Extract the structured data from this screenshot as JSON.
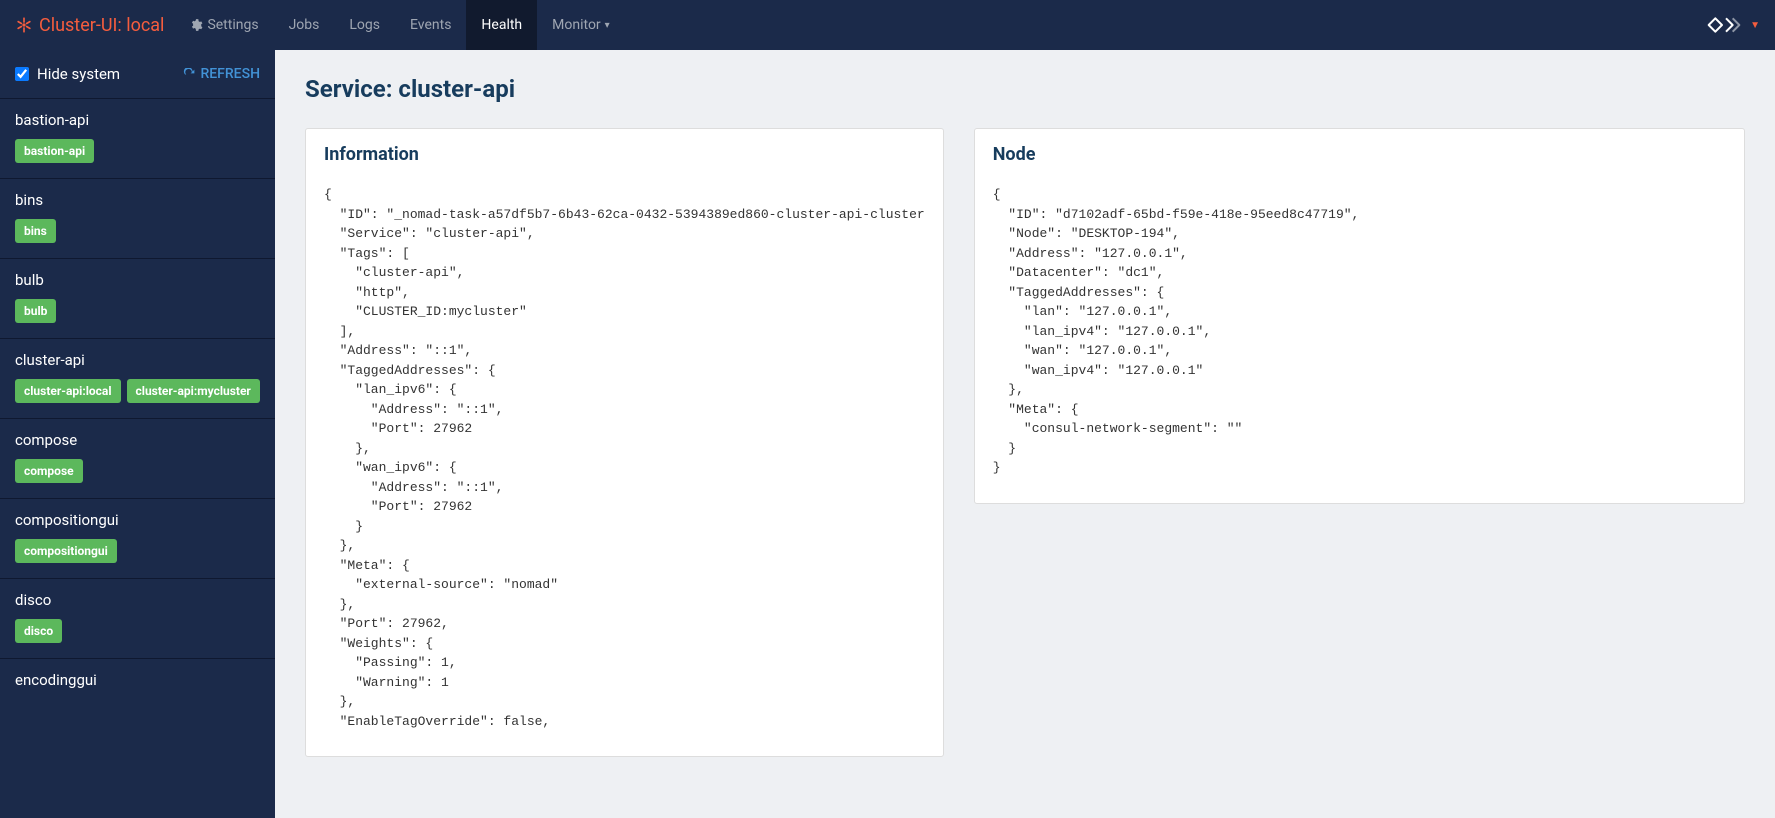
{
  "navbar": {
    "brand": "Cluster-UI: local",
    "settings": "Settings",
    "items": [
      "Jobs",
      "Logs",
      "Events",
      "Health",
      "Monitor"
    ],
    "active": "Health"
  },
  "sidebar": {
    "hide_label": "Hide system",
    "hide_checked": true,
    "refresh": "REFRESH",
    "services": [
      {
        "name": "bastion-api",
        "tags": [
          "bastion-api"
        ]
      },
      {
        "name": "bins",
        "tags": [
          "bins"
        ]
      },
      {
        "name": "bulb",
        "tags": [
          "bulb"
        ]
      },
      {
        "name": "cluster-api",
        "tags": [
          "cluster-api:local",
          "cluster-api:mycluster"
        ]
      },
      {
        "name": "compose",
        "tags": [
          "compose"
        ]
      },
      {
        "name": "compositiongui",
        "tags": [
          "compositiongui"
        ]
      },
      {
        "name": "disco",
        "tags": [
          "disco"
        ]
      },
      {
        "name": "encodinggui",
        "tags": []
      }
    ]
  },
  "page": {
    "title": "Service: cluster-api",
    "info_header": "Information",
    "node_header": "Node",
    "info_json": "{\n  \"ID\": \"_nomad-task-a57df5b7-6b43-62ca-0432-5394389ed860-cluster-api-cluster\n  \"Service\": \"cluster-api\",\n  \"Tags\": [\n    \"cluster-api\",\n    \"http\",\n    \"CLUSTER_ID:mycluster\"\n  ],\n  \"Address\": \"::1\",\n  \"TaggedAddresses\": {\n    \"lan_ipv6\": {\n      \"Address\": \"::1\",\n      \"Port\": 27962\n    },\n    \"wan_ipv6\": {\n      \"Address\": \"::1\",\n      \"Port\": 27962\n    }\n  },\n  \"Meta\": {\n    \"external-source\": \"nomad\"\n  },\n  \"Port\": 27962,\n  \"Weights\": {\n    \"Passing\": 1,\n    \"Warning\": 1\n  },\n  \"EnableTagOverride\": false,",
    "node_json": "{\n  \"ID\": \"d7102adf-65bd-f59e-418e-95eed8c47719\",\n  \"Node\": \"DESKTOP-194\",\n  \"Address\": \"127.0.0.1\",\n  \"Datacenter\": \"dc1\",\n  \"TaggedAddresses\": {\n    \"lan\": \"127.0.0.1\",\n    \"lan_ipv4\": \"127.0.0.1\",\n    \"wan\": \"127.0.0.1\",\n    \"wan_ipv4\": \"127.0.0.1\"\n  },\n  \"Meta\": {\n    \"consul-network-segment\": \"\"\n  }\n}"
  }
}
